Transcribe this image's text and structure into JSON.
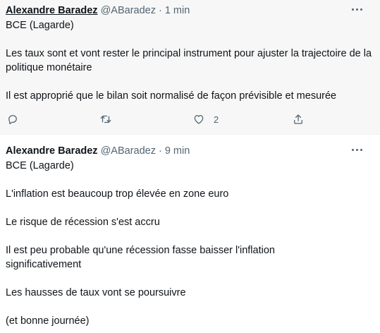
{
  "tweets": [
    {
      "name": "Alexandre Baradez",
      "handle": "@ABaradez",
      "separator": "·",
      "time": "1 min",
      "paragraphs": [
        "BCE (Lagarde)",
        "Les taux sont et vont rester le principal instrument pour ajuster la trajectoire de la politique monétaire",
        "Il est approprié que le bilan soit normalisé de façon prévisible et mesurée"
      ],
      "actions": {
        "reply_icon": "reply-icon",
        "retweet_icon": "retweet-icon",
        "like_icon": "like-icon",
        "like_count": "2",
        "share_icon": "share-icon"
      }
    },
    {
      "name": "Alexandre Baradez",
      "handle": "@ABaradez",
      "separator": "·",
      "time": "9 min",
      "paragraphs": [
        "BCE (Lagarde)",
        "L'inflation est beaucoup trop élevée en zone euro",
        "Le risque de récession s'est accru",
        "Il est peu probable qu'une récession fasse baisser l'inflation significativement",
        "Les hausses de taux vont se poursuivre",
        "(et bonne journée)"
      ]
    }
  ],
  "colors": {
    "text": "#0f1419",
    "secondary": "#536471",
    "hover_background": "#f7f7f7",
    "divider": "#eff3f4"
  }
}
